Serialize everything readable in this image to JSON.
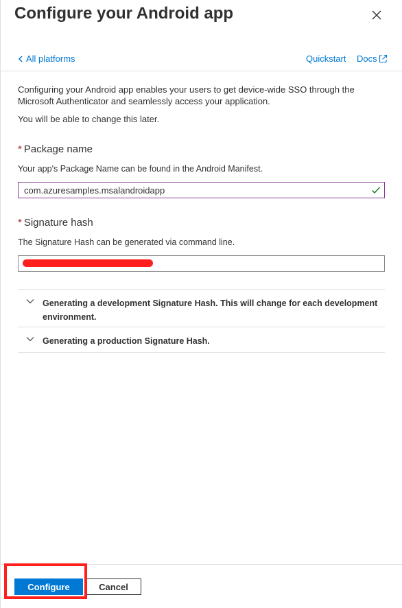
{
  "header": {
    "title": "Configure your Android app",
    "close_icon": "close-icon"
  },
  "nav": {
    "back_label": "All platforms",
    "quickstart_label": "Quickstart",
    "docs_label": "Docs",
    "docs_icon": "external-link-icon"
  },
  "intro": {
    "text": "Configuring your Android app enables your users to get device-wide SSO through the Microsoft Authenticator and seamlessly access your application.",
    "note": "You will be able to change this later."
  },
  "package_name": {
    "required_mark": "*",
    "label": "Package name",
    "help": "Your app's Package Name can be found in the Android Manifest.",
    "value": "com.azuresamples.msalandroidapp",
    "valid_icon": "checkmark-icon"
  },
  "signature_hash": {
    "required_mark": "*",
    "label": "Signature hash",
    "help": "The Signature Hash can be generated via command line."
  },
  "accordions": [
    {
      "title": "Generating a development Signature Hash. This will change for each development environment."
    },
    {
      "title": "Generating a production Signature Hash."
    }
  ],
  "footer": {
    "configure_label": "Configure",
    "cancel_label": "Cancel"
  },
  "colors": {
    "accent": "#0078d4",
    "required": "#a4262c",
    "valid_check": "#107c10",
    "highlight": "#ff1e1e"
  }
}
